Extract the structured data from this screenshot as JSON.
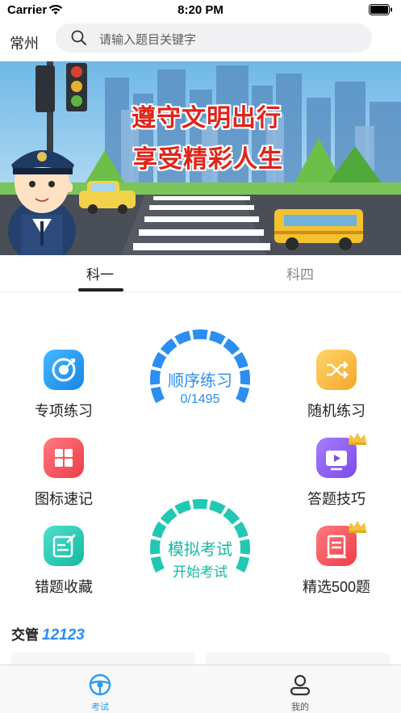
{
  "status_bar": {
    "carrier": "Carrier",
    "time": "8:20 PM"
  },
  "header": {
    "city": "常州",
    "search_placeholder": "请输入题目关键字"
  },
  "banner": {
    "line1": "遵守文明出行",
    "line2": "享受精彩人生"
  },
  "subject_tabs": [
    {
      "label": "科一",
      "selected": true
    },
    {
      "label": "科四",
      "selected": false
    }
  ],
  "features": {
    "special": {
      "label": "专项练习",
      "icon": "target-icon",
      "color": "#1f9cf0"
    },
    "random": {
      "label": "随机练习",
      "icon": "shuffle-icon",
      "color": "#f5b63a"
    },
    "signs": {
      "label": "图标速记",
      "icon": "grid-icon",
      "color": "#f0505a"
    },
    "tips": {
      "label": "答题技巧",
      "icon": "video-vip-icon",
      "color": "#8a5bf0"
    },
    "mistakes": {
      "label": "错题收藏",
      "icon": "edit-note-icon",
      "color": "#22c8b4"
    },
    "selected500": {
      "label": "精选500题",
      "icon": "book-vip-icon",
      "color": "#f0505a"
    }
  },
  "sequential": {
    "title": "顺序练习",
    "progress": "0/1495",
    "color": "#2b8ef0"
  },
  "mock_exam": {
    "title": "模拟考试",
    "subtitle": "开始考试",
    "color": "#22c8b4"
  },
  "section": {
    "prefix": "交管",
    "highlight": "12123"
  },
  "tabbar": [
    {
      "label": "考试",
      "icon": "steering-wheel-icon",
      "active": true
    },
    {
      "label": "我的",
      "icon": "person-icon",
      "active": false
    }
  ],
  "colors": {
    "accent": "#2b8ef0",
    "teal": "#22c8b4",
    "banner_text": "#e0241a"
  }
}
